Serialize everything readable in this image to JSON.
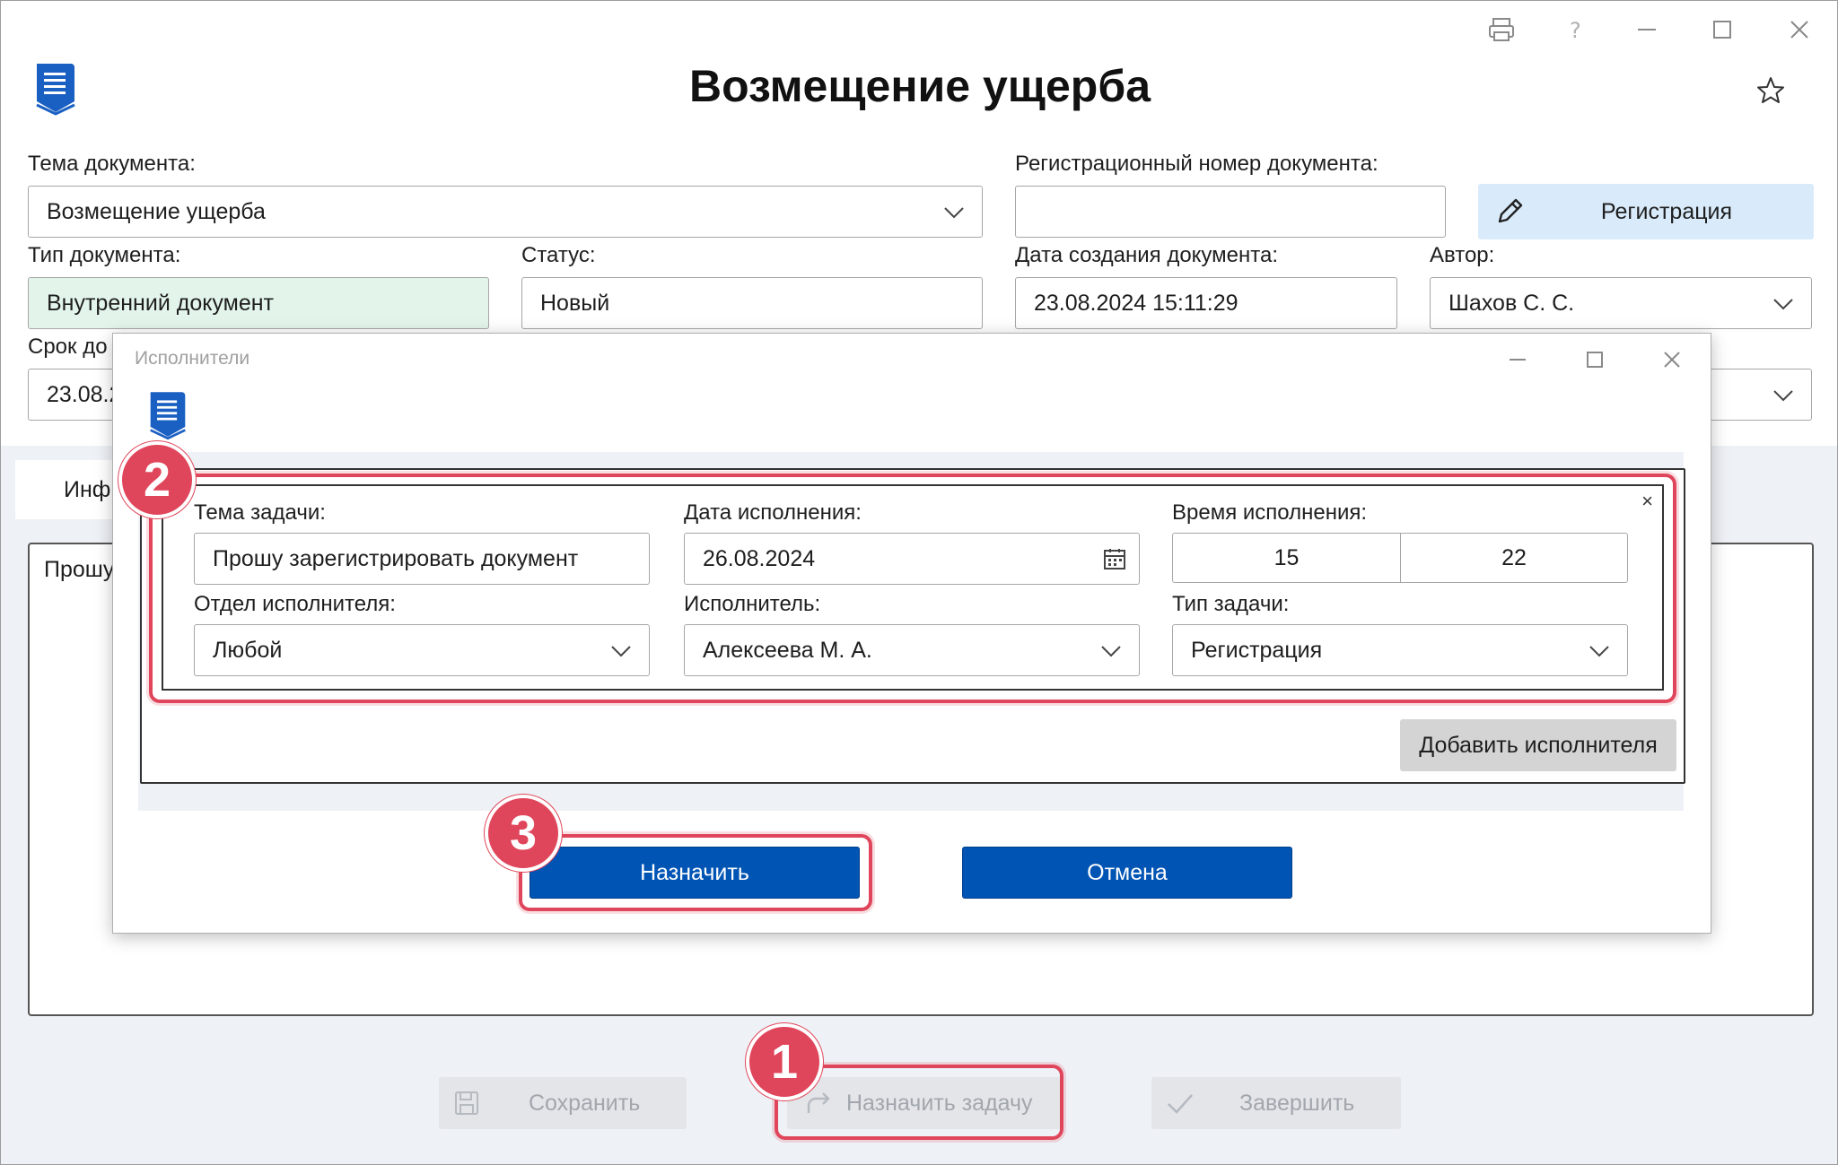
{
  "window": {
    "title": "Возмещение ущерба"
  },
  "form": {
    "subject_label": "Тема документа:",
    "subject_value": "Возмещение ущерба",
    "regnum_label": "Регистрационный номер документа:",
    "regnum_value": "",
    "register_button": "Регистрация",
    "doctype_label": "Тип документа:",
    "doctype_value": "Внутренний документ",
    "status_label": "Статус:",
    "status_value": "Новый",
    "created_label": "Дата создания документа:",
    "created_value": "23.08.2024 15:11:29",
    "author_label": "Автор:",
    "author_value": "Шахов С. С.",
    "deadline_label_partial": "Срок до",
    "deadline_value_partial": "23.08.2",
    "tab_partial": "Инф",
    "text_partial": "Прошу"
  },
  "footer": {
    "save_label": "Сохранить",
    "assign_task_label": "Назначить задачу",
    "finish_label": "Завершить"
  },
  "dialog": {
    "title": "Исполнители",
    "task_subject_label": "Тема задачи:",
    "task_subject_value": "Прошу зарегистрировать документ",
    "due_date_label": "Дата исполнения:",
    "due_date_value": "26.08.2024",
    "due_time_label": "Время исполнения:",
    "due_hours": "15",
    "due_minutes": "22",
    "department_label": "Отдел исполнителя:",
    "department_value": "Любой",
    "executor_label": "Исполнитель:",
    "executor_value": "Алексеева М. А.",
    "task_type_label": "Тип задачи:",
    "task_type_value": "Регистрация",
    "remove_symbol": "×",
    "add_executor_button": "Добавить исполнителя",
    "assign_button": "Назначить",
    "cancel_button": "Отмена"
  },
  "annotations": {
    "step1": "1",
    "step2": "2",
    "step3": "3"
  },
  "colors": {
    "accent": "#0054b4",
    "highlight": "#e0465b",
    "doctype_bg": "#e3f5ea",
    "register_bg": "#d9ebfb"
  },
  "icons": [
    "document-logo-icon",
    "printer-icon",
    "help-icon",
    "minimize-icon",
    "maximize-icon",
    "close-icon",
    "star-icon",
    "chevron-down-icon",
    "pencil-icon",
    "calendar-icon",
    "save-icon",
    "assign-arrow-icon",
    "checkmark-icon"
  ]
}
